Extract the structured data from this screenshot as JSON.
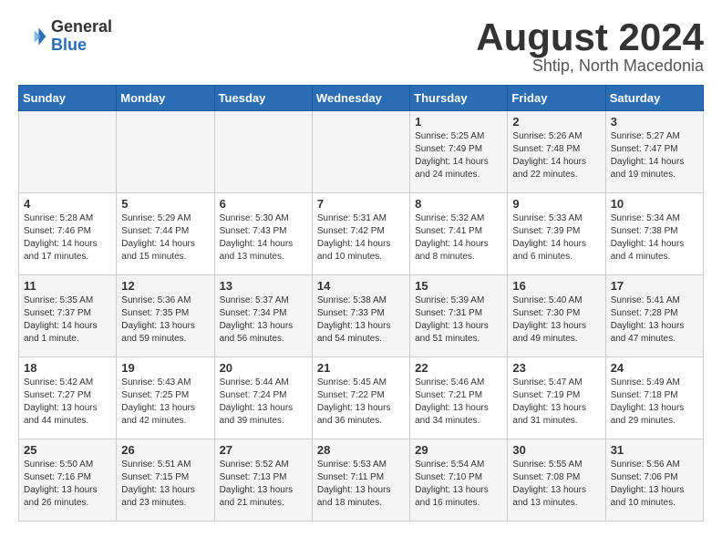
{
  "logo": {
    "general": "General",
    "blue": "Blue"
  },
  "title": {
    "month_year": "August 2024",
    "location": "Shtip, North Macedonia"
  },
  "headers": [
    "Sunday",
    "Monday",
    "Tuesday",
    "Wednesday",
    "Thursday",
    "Friday",
    "Saturday"
  ],
  "weeks": [
    [
      {
        "day": "",
        "info": ""
      },
      {
        "day": "",
        "info": ""
      },
      {
        "day": "",
        "info": ""
      },
      {
        "day": "",
        "info": ""
      },
      {
        "day": "1",
        "sunrise": "5:25 AM",
        "sunset": "7:49 PM",
        "daylight": "14 hours and 24 minutes."
      },
      {
        "day": "2",
        "sunrise": "5:26 AM",
        "sunset": "7:48 PM",
        "daylight": "14 hours and 22 minutes."
      },
      {
        "day": "3",
        "sunrise": "5:27 AM",
        "sunset": "7:47 PM",
        "daylight": "14 hours and 19 minutes."
      }
    ],
    [
      {
        "day": "4",
        "sunrise": "5:28 AM",
        "sunset": "7:46 PM",
        "daylight": "14 hours and 17 minutes."
      },
      {
        "day": "5",
        "sunrise": "5:29 AM",
        "sunset": "7:44 PM",
        "daylight": "14 hours and 15 minutes."
      },
      {
        "day": "6",
        "sunrise": "5:30 AM",
        "sunset": "7:43 PM",
        "daylight": "14 hours and 13 minutes."
      },
      {
        "day": "7",
        "sunrise": "5:31 AM",
        "sunset": "7:42 PM",
        "daylight": "14 hours and 10 minutes."
      },
      {
        "day": "8",
        "sunrise": "5:32 AM",
        "sunset": "7:41 PM",
        "daylight": "14 hours and 8 minutes."
      },
      {
        "day": "9",
        "sunrise": "5:33 AM",
        "sunset": "7:39 PM",
        "daylight": "14 hours and 6 minutes."
      },
      {
        "day": "10",
        "sunrise": "5:34 AM",
        "sunset": "7:38 PM",
        "daylight": "14 hours and 4 minutes."
      }
    ],
    [
      {
        "day": "11",
        "sunrise": "5:35 AM",
        "sunset": "7:37 PM",
        "daylight": "14 hours and 1 minute."
      },
      {
        "day": "12",
        "sunrise": "5:36 AM",
        "sunset": "7:35 PM",
        "daylight": "13 hours and 59 minutes."
      },
      {
        "day": "13",
        "sunrise": "5:37 AM",
        "sunset": "7:34 PM",
        "daylight": "13 hours and 56 minutes."
      },
      {
        "day": "14",
        "sunrise": "5:38 AM",
        "sunset": "7:33 PM",
        "daylight": "13 hours and 54 minutes."
      },
      {
        "day": "15",
        "sunrise": "5:39 AM",
        "sunset": "7:31 PM",
        "daylight": "13 hours and 51 minutes."
      },
      {
        "day": "16",
        "sunrise": "5:40 AM",
        "sunset": "7:30 PM",
        "daylight": "13 hours and 49 minutes."
      },
      {
        "day": "17",
        "sunrise": "5:41 AM",
        "sunset": "7:28 PM",
        "daylight": "13 hours and 47 minutes."
      }
    ],
    [
      {
        "day": "18",
        "sunrise": "5:42 AM",
        "sunset": "7:27 PM",
        "daylight": "13 hours and 44 minutes."
      },
      {
        "day": "19",
        "sunrise": "5:43 AM",
        "sunset": "7:25 PM",
        "daylight": "13 hours and 42 minutes."
      },
      {
        "day": "20",
        "sunrise": "5:44 AM",
        "sunset": "7:24 PM",
        "daylight": "13 hours and 39 minutes."
      },
      {
        "day": "21",
        "sunrise": "5:45 AM",
        "sunset": "7:22 PM",
        "daylight": "13 hours and 36 minutes."
      },
      {
        "day": "22",
        "sunrise": "5:46 AM",
        "sunset": "7:21 PM",
        "daylight": "13 hours and 34 minutes."
      },
      {
        "day": "23",
        "sunrise": "5:47 AM",
        "sunset": "7:19 PM",
        "daylight": "13 hours and 31 minutes."
      },
      {
        "day": "24",
        "sunrise": "5:49 AM",
        "sunset": "7:18 PM",
        "daylight": "13 hours and 29 minutes."
      }
    ],
    [
      {
        "day": "25",
        "sunrise": "5:50 AM",
        "sunset": "7:16 PM",
        "daylight": "13 hours and 26 minutes."
      },
      {
        "day": "26",
        "sunrise": "5:51 AM",
        "sunset": "7:15 PM",
        "daylight": "13 hours and 23 minutes."
      },
      {
        "day": "27",
        "sunrise": "5:52 AM",
        "sunset": "7:13 PM",
        "daylight": "13 hours and 21 minutes."
      },
      {
        "day": "28",
        "sunrise": "5:53 AM",
        "sunset": "7:11 PM",
        "daylight": "13 hours and 18 minutes."
      },
      {
        "day": "29",
        "sunrise": "5:54 AM",
        "sunset": "7:10 PM",
        "daylight": "13 hours and 16 minutes."
      },
      {
        "day": "30",
        "sunrise": "5:55 AM",
        "sunset": "7:08 PM",
        "daylight": "13 hours and 13 minutes."
      },
      {
        "day": "31",
        "sunrise": "5:56 AM",
        "sunset": "7:06 PM",
        "daylight": "13 hours and 10 minutes."
      }
    ]
  ]
}
